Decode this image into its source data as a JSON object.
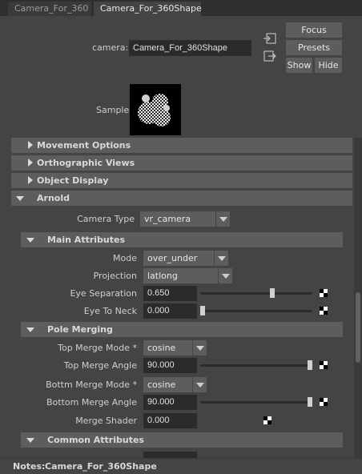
{
  "tabs": [
    "Camera_For_360",
    "Camera_For_360Shape"
  ],
  "header": {
    "node_label": "camera:",
    "node_value": "Camera_For_360Shape",
    "focus": "Focus",
    "presets": "Presets",
    "show": "Show",
    "hide": "Hide",
    "sample_label": "Sample"
  },
  "sections": {
    "movement": "Movement Options",
    "ortho": "Orthographic Views",
    "object_display": "Object Display",
    "arnold": "Arnold",
    "main_attrs": "Main Attributes",
    "pole_merging": "Pole Merging",
    "common_attrs": "Common Attributes"
  },
  "arnold": {
    "camera_type_label": "Camera Type",
    "camera_type_value": "vr_camera"
  },
  "main": {
    "mode_label": "Mode",
    "mode_value": "over_under",
    "projection_label": "Projection",
    "projection_value": "latlong",
    "eye_sep_label": "Eye Separation",
    "eye_sep_value": "0.650",
    "eye_sep_slider": 0.65,
    "eye_neck_label": "Eye To Neck",
    "eye_neck_value": "0.000",
    "eye_neck_slider": 0.0
  },
  "pole": {
    "top_mode_label": "Top Merge Mode *",
    "top_mode_value": "cosine",
    "top_angle_label": "Top Merge Angle",
    "top_angle_value": "90.000",
    "top_angle_slider": 1.0,
    "bottom_mode_label": "Bottm Merge Mode *",
    "bottom_mode_value": "cosine",
    "bottom_angle_label": "Bottom Merge Angle",
    "bottom_angle_value": "90.000",
    "bottom_angle_slider": 1.0,
    "shader_label": "Merge Shader",
    "shader_value": "0.000"
  },
  "notes": {
    "label": "Notes:",
    "value": "Camera_For_360Shape"
  }
}
